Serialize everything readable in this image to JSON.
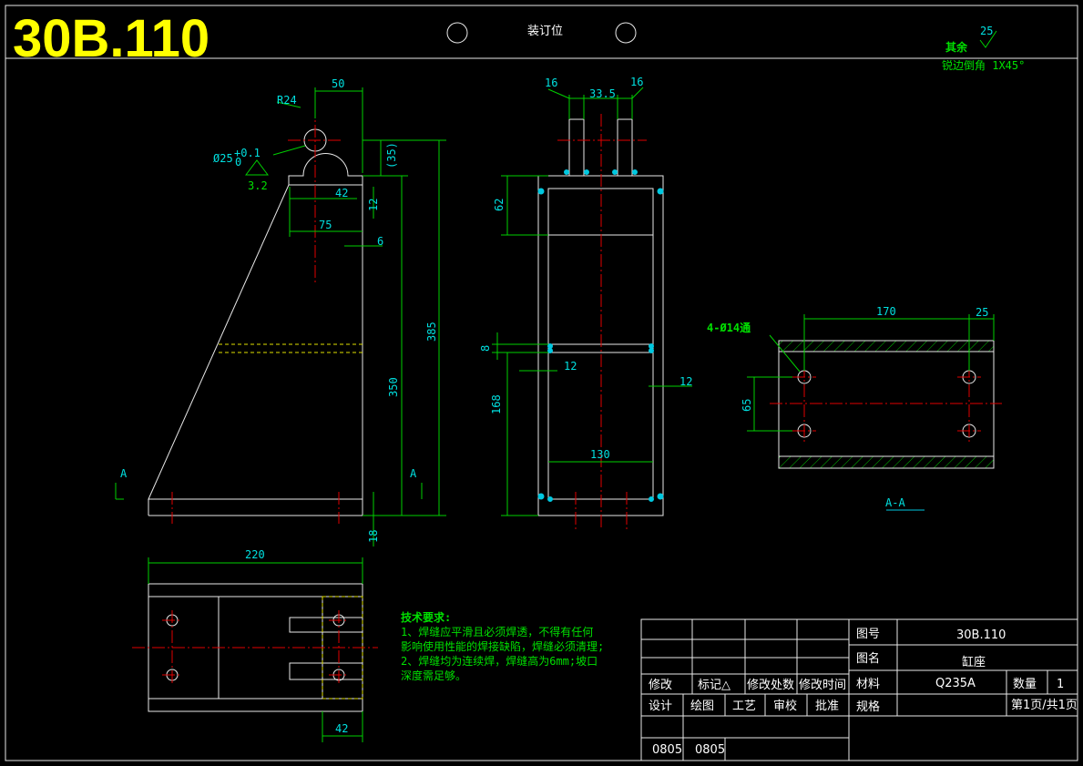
{
  "drawing_number_big": "30B.110",
  "binding_label": "装订位",
  "surface": {
    "rest_label": "其余",
    "roughness": "25",
    "chamfer": "锐边倒角 1X45°"
  },
  "front_view": {
    "radius": "R24",
    "hole": "Ø25",
    "tol_plus": "+0.1",
    "tol_zero": "0",
    "roughness": "3.2",
    "dim_50": "50",
    "dim_35": "(35)",
    "dim_42": "42",
    "dim_12": "12",
    "dim_75": "75",
    "dim_6": "6",
    "dim_385": "385",
    "dim_350": "350",
    "dim_18": "18",
    "section_left": "A",
    "section_right": "A"
  },
  "side_view": {
    "dim_16a": "16",
    "dim_335": "33.5",
    "dim_16b": "16",
    "dim_62": "62",
    "dim_8": "8",
    "dim_12a": "12",
    "dim_12b": "12",
    "dim_168": "168",
    "dim_130": "130"
  },
  "section_view": {
    "holes": "4-Ø14通",
    "dim_170": "170",
    "dim_25": "25",
    "dim_65": "65",
    "title": "A-A"
  },
  "top_view": {
    "dim_220": "220",
    "dim_42": "42"
  },
  "notes": {
    "title": "技术要求:",
    "line1": "1、焊缝应平滑且必须焊透，不得有任何",
    "line2": "影响使用性能的焊接缺陷，焊缝必须清理;",
    "line3": "2、焊缝均为连续焊，焊缝高为6mm;坡口",
    "line4": "深度需足够。"
  },
  "title_block": {
    "rev_headers": [
      "修改",
      "标记△",
      "修改处数",
      "修改时间"
    ],
    "sign_headers": [
      "设计",
      "绘图",
      "工艺",
      "审校",
      "批准"
    ],
    "dates": [
      "0805",
      "0805"
    ],
    "drawing_no_label": "图号",
    "drawing_no": "30B.110",
    "name_label": "图名",
    "name": "缸座",
    "material_label": "材料",
    "material": "Q235A",
    "qty_label": "数量",
    "qty": "1",
    "spec_label": "规格",
    "page": "第1页/共1页"
  },
  "colors": {
    "outline": "#e8e8e8",
    "dimension": "#00d000",
    "centerline": "#e00000",
    "hidden": "#e0e000",
    "dim_text": "#00e0e0",
    "title": "#ffff00"
  }
}
